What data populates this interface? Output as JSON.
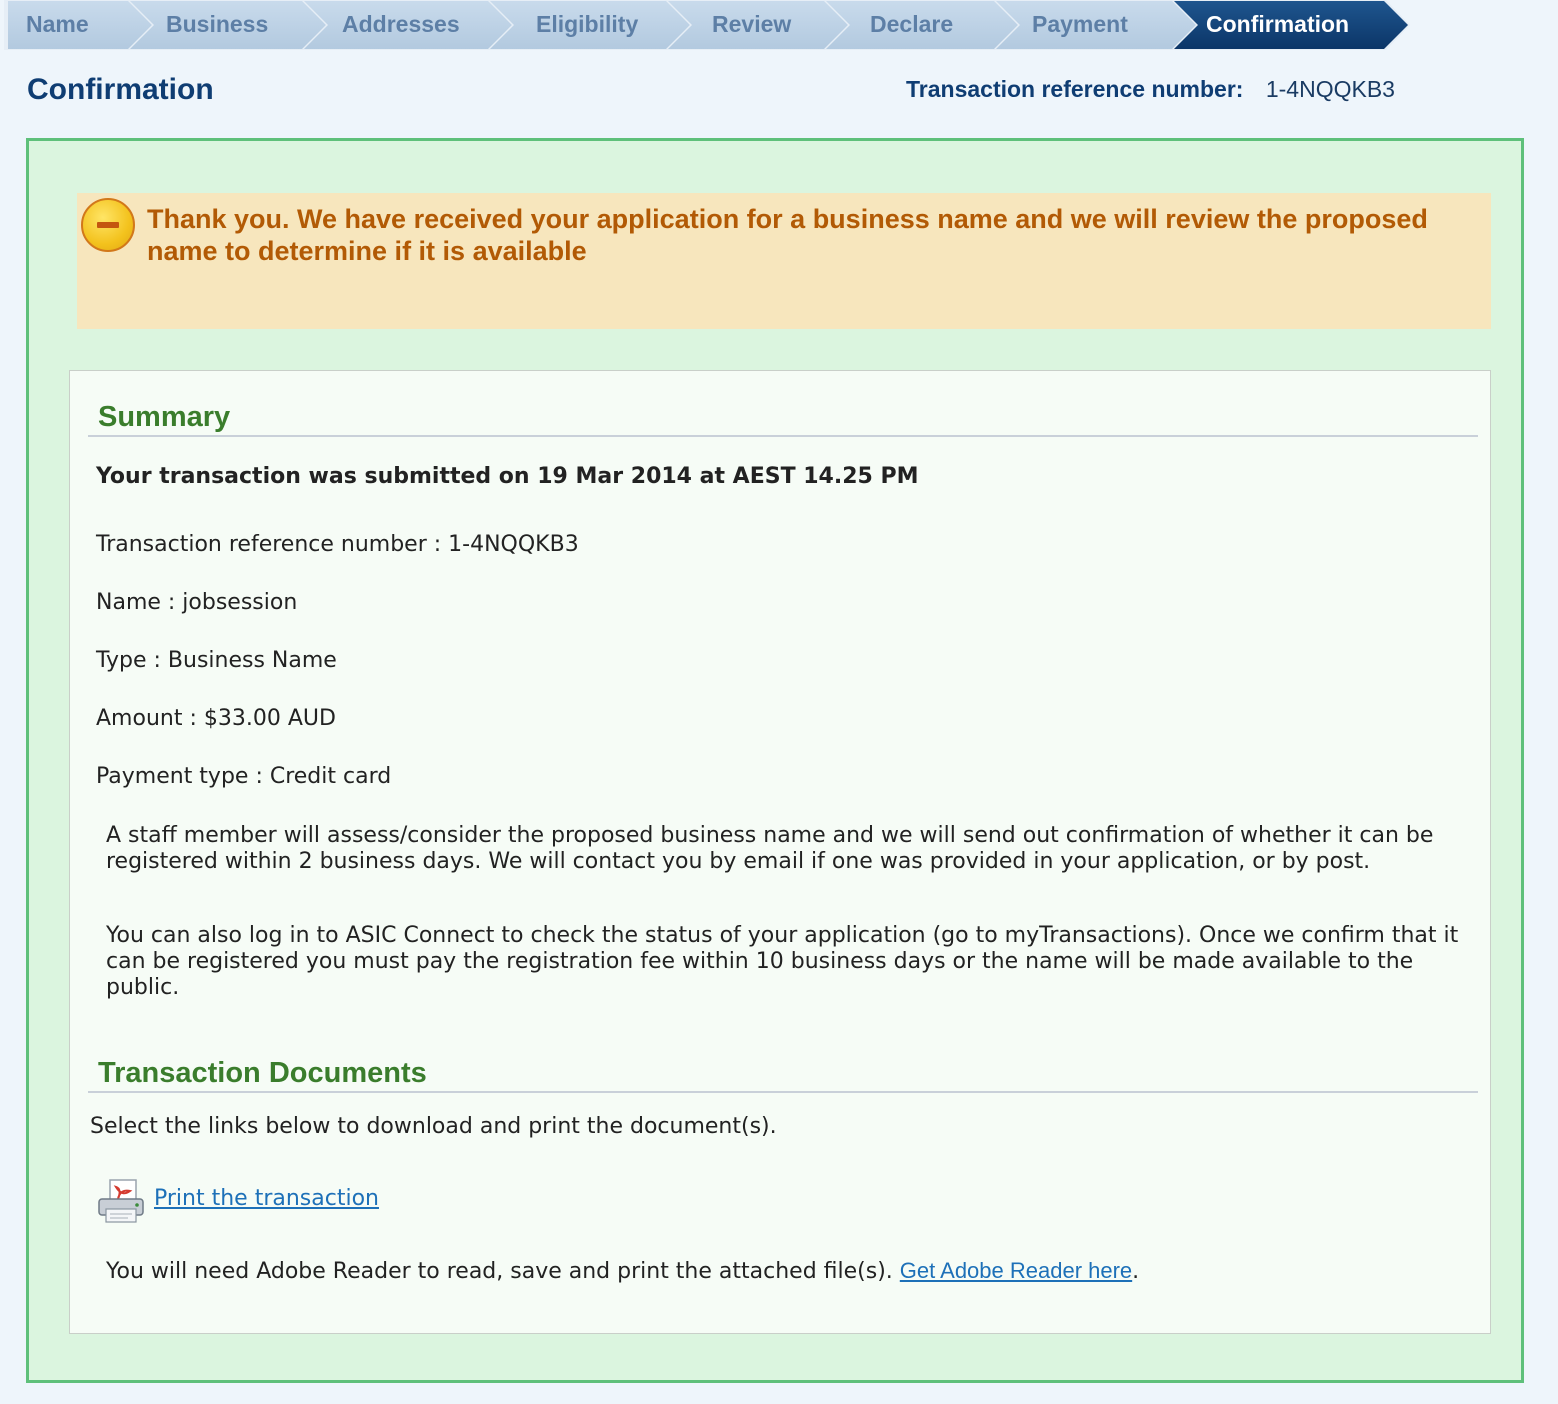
{
  "steps": [
    {
      "label": "Name",
      "active": false
    },
    {
      "label": "Business",
      "active": false
    },
    {
      "label": "Addresses",
      "active": false
    },
    {
      "label": "Eligibility",
      "active": false
    },
    {
      "label": "Review",
      "active": false
    },
    {
      "label": "Declare",
      "active": false
    },
    {
      "label": "Payment",
      "active": false
    },
    {
      "label": "Confirmation",
      "active": true
    }
  ],
  "header": {
    "title": "Confirmation",
    "ref_label": "Transaction reference number:",
    "ref_value": "1-4NQQKB3"
  },
  "notice": {
    "icon": "minus-circle-icon",
    "text": "Thank you. We have received your application for a business name and we will review the proposed name to determine if it is available"
  },
  "summary": {
    "heading": "Summary",
    "submitted": "Your transaction was submitted on 19 Mar 2014 at AEST 14.25 PM",
    "fields": {
      "reference": "Transaction reference number : 1-4NQQKB3",
      "name": "Name : jobsession",
      "type": "Type : Business Name",
      "amount": "Amount : $33.00 AUD",
      "payment_type": "Payment type : Credit card"
    },
    "paragraph1": "A staff member will assess/consider the proposed business name and we will send out confirmation of whether it can be registered within 2 business days. We will contact you by email if one was provided in your application, or by post.",
    "paragraph2": "You can also log in to ASIC Connect to check the status of your application (go to myTransactions). Once we confirm that it can be registered you must pay the registration fee within 10 business days or the name will be made available to the public."
  },
  "documents": {
    "heading": "Transaction Documents",
    "intro": "Select the links below to download and print the document(s).",
    "print_icon": "print-pdf-icon",
    "print_link": "Print the transaction",
    "adobe_text": "You will need Adobe Reader to read, save and print the attached file(s). ",
    "adobe_link": "Get Adobe Reader here",
    "adobe_suffix": "."
  },
  "colors": {
    "panel_border": "#5ec07a",
    "panel_bg": "#dbf5df",
    "notice_bg": "#f7e6bd",
    "notice_text": "#b25a05",
    "heading_green": "#3a7d2c",
    "title_blue": "#0f3d73",
    "link_blue": "#1d70b8",
    "step_active": "#0b3567"
  }
}
